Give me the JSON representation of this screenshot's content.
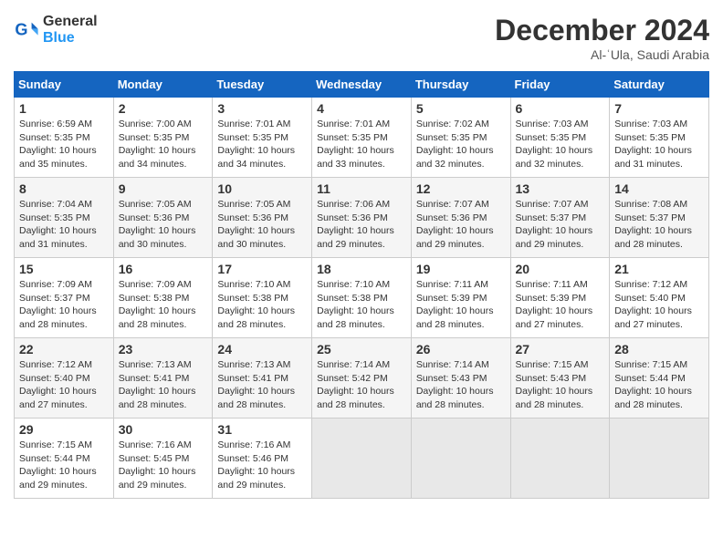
{
  "logo": {
    "line1": "General",
    "line2": "Blue"
  },
  "title": "December 2024",
  "subtitle": "Al-ʿUla, Saudi Arabia",
  "headers": [
    "Sunday",
    "Monday",
    "Tuesday",
    "Wednesday",
    "Thursday",
    "Friday",
    "Saturday"
  ],
  "weeks": [
    [
      {
        "day": "1",
        "rise": "6:59 AM",
        "set": "5:35 PM",
        "daylight": "10 hours and 35 minutes."
      },
      {
        "day": "2",
        "rise": "7:00 AM",
        "set": "5:35 PM",
        "daylight": "10 hours and 34 minutes."
      },
      {
        "day": "3",
        "rise": "7:01 AM",
        "set": "5:35 PM",
        "daylight": "10 hours and 34 minutes."
      },
      {
        "day": "4",
        "rise": "7:01 AM",
        "set": "5:35 PM",
        "daylight": "10 hours and 33 minutes."
      },
      {
        "day": "5",
        "rise": "7:02 AM",
        "set": "5:35 PM",
        "daylight": "10 hours and 32 minutes."
      },
      {
        "day": "6",
        "rise": "7:03 AM",
        "set": "5:35 PM",
        "daylight": "10 hours and 32 minutes."
      },
      {
        "day": "7",
        "rise": "7:03 AM",
        "set": "5:35 PM",
        "daylight": "10 hours and 31 minutes."
      }
    ],
    [
      {
        "day": "8",
        "rise": "7:04 AM",
        "set": "5:35 PM",
        "daylight": "10 hours and 31 minutes."
      },
      {
        "day": "9",
        "rise": "7:05 AM",
        "set": "5:36 PM",
        "daylight": "10 hours and 30 minutes."
      },
      {
        "day": "10",
        "rise": "7:05 AM",
        "set": "5:36 PM",
        "daylight": "10 hours and 30 minutes."
      },
      {
        "day": "11",
        "rise": "7:06 AM",
        "set": "5:36 PM",
        "daylight": "10 hours and 29 minutes."
      },
      {
        "day": "12",
        "rise": "7:07 AM",
        "set": "5:36 PM",
        "daylight": "10 hours and 29 minutes."
      },
      {
        "day": "13",
        "rise": "7:07 AM",
        "set": "5:37 PM",
        "daylight": "10 hours and 29 minutes."
      },
      {
        "day": "14",
        "rise": "7:08 AM",
        "set": "5:37 PM",
        "daylight": "10 hours and 28 minutes."
      }
    ],
    [
      {
        "day": "15",
        "rise": "7:09 AM",
        "set": "5:37 PM",
        "daylight": "10 hours and 28 minutes."
      },
      {
        "day": "16",
        "rise": "7:09 AM",
        "set": "5:38 PM",
        "daylight": "10 hours and 28 minutes."
      },
      {
        "day": "17",
        "rise": "7:10 AM",
        "set": "5:38 PM",
        "daylight": "10 hours and 28 minutes."
      },
      {
        "day": "18",
        "rise": "7:10 AM",
        "set": "5:38 PM",
        "daylight": "10 hours and 28 minutes."
      },
      {
        "day": "19",
        "rise": "7:11 AM",
        "set": "5:39 PM",
        "daylight": "10 hours and 28 minutes."
      },
      {
        "day": "20",
        "rise": "7:11 AM",
        "set": "5:39 PM",
        "daylight": "10 hours and 27 minutes."
      },
      {
        "day": "21",
        "rise": "7:12 AM",
        "set": "5:40 PM",
        "daylight": "10 hours and 27 minutes."
      }
    ],
    [
      {
        "day": "22",
        "rise": "7:12 AM",
        "set": "5:40 PM",
        "daylight": "10 hours and 27 minutes."
      },
      {
        "day": "23",
        "rise": "7:13 AM",
        "set": "5:41 PM",
        "daylight": "10 hours and 28 minutes."
      },
      {
        "day": "24",
        "rise": "7:13 AM",
        "set": "5:41 PM",
        "daylight": "10 hours and 28 minutes."
      },
      {
        "day": "25",
        "rise": "7:14 AM",
        "set": "5:42 PM",
        "daylight": "10 hours and 28 minutes."
      },
      {
        "day": "26",
        "rise": "7:14 AM",
        "set": "5:43 PM",
        "daylight": "10 hours and 28 minutes."
      },
      {
        "day": "27",
        "rise": "7:15 AM",
        "set": "5:43 PM",
        "daylight": "10 hours and 28 minutes."
      },
      {
        "day": "28",
        "rise": "7:15 AM",
        "set": "5:44 PM",
        "daylight": "10 hours and 28 minutes."
      }
    ],
    [
      {
        "day": "29",
        "rise": "7:15 AM",
        "set": "5:44 PM",
        "daylight": "10 hours and 29 minutes."
      },
      {
        "day": "30",
        "rise": "7:16 AM",
        "set": "5:45 PM",
        "daylight": "10 hours and 29 minutes."
      },
      {
        "day": "31",
        "rise": "7:16 AM",
        "set": "5:46 PM",
        "daylight": "10 hours and 29 minutes."
      },
      null,
      null,
      null,
      null
    ]
  ]
}
